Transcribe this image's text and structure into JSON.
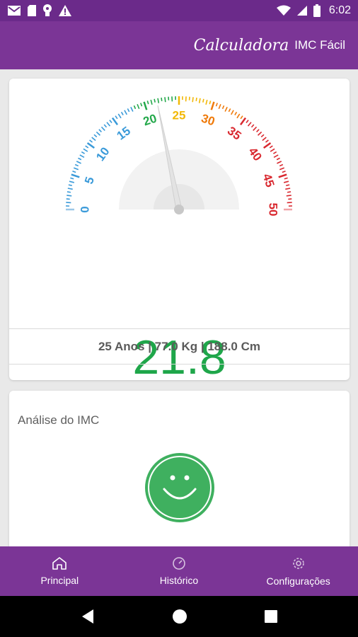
{
  "status_bar": {
    "time": "6:02",
    "icons": [
      "gmail-icon",
      "sd-card-icon",
      "lightbulb-icon",
      "warning-icon",
      "wifi-icon",
      "signal-icon",
      "battery-icon"
    ]
  },
  "app_bar": {
    "title_script": "Calculadora",
    "title_main": "IMC Fácil"
  },
  "gauge": {
    "tick_labels": [
      "0",
      "5",
      "10",
      "15",
      "20",
      "25",
      "30",
      "35",
      "40",
      "45",
      "50"
    ],
    "min": 0,
    "max": 50,
    "needle_value": 21.8,
    "colors": {
      "blue": "#3a9ad9",
      "green": "#23a84a",
      "yellow": "#f2b807",
      "orange": "#ef7a0a",
      "red": "#d9282f"
    }
  },
  "result": {
    "bmi": "21.8",
    "bmi_color": "#1fa64a",
    "details": "25 Anos | 77.0 Kg | 188.0 Cm"
  },
  "analysis": {
    "title": "Análise do IMC",
    "face_color": "#3fb05f"
  },
  "bottom_nav": {
    "items": [
      {
        "label": "Principal",
        "icon": "home-icon"
      },
      {
        "label": "Histórico",
        "icon": "history-icon"
      },
      {
        "label": "Configurações",
        "icon": "settings-icon"
      }
    ]
  }
}
